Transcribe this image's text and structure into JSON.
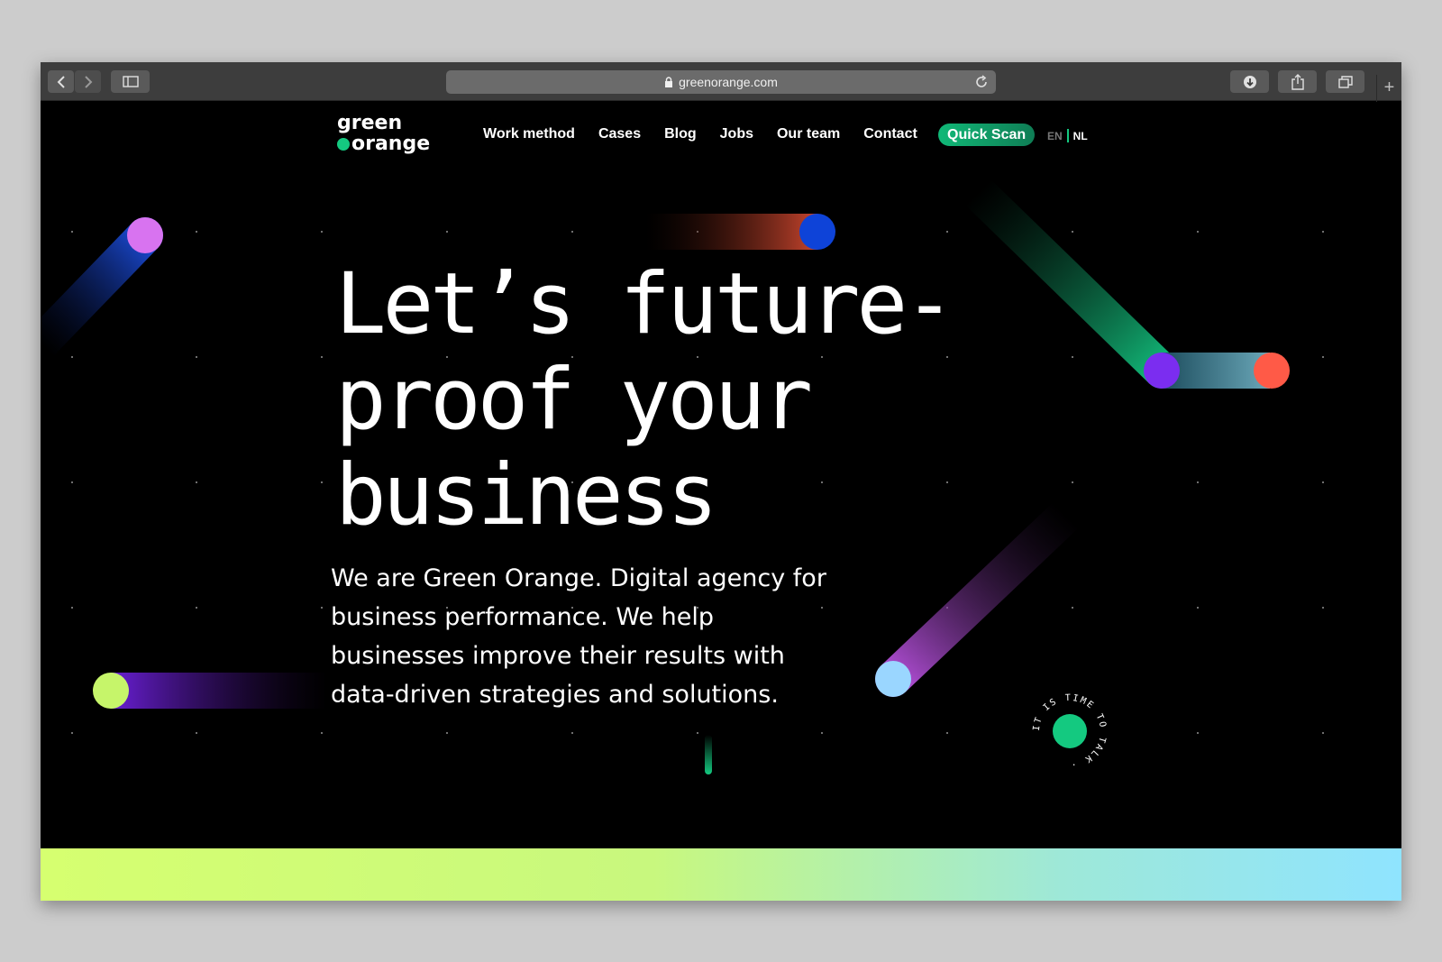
{
  "browser": {
    "url": "greenorange.com",
    "icons": {
      "back": "chevron-left-icon",
      "forward": "chevron-right-icon",
      "sidebar": "sidebar-icon",
      "lock": "lock-icon",
      "reload": "reload-icon",
      "download": "download-icon",
      "share": "share-icon",
      "tabs": "tabs-icon",
      "new_tab": "plus-icon"
    }
  },
  "site": {
    "logo": {
      "line1": "green",
      "line2": "orange"
    },
    "nav": [
      "Work method",
      "Cases",
      "Blog",
      "Jobs",
      "Our team",
      "Contact"
    ],
    "quick_scan": "Quick Scan",
    "lang": {
      "en": "EN",
      "nl": "NL"
    },
    "hero": {
      "line1": "Let’s future-",
      "line2": "proof your",
      "line3": "business"
    },
    "intro": "We are Green Orange. Digital agency for business performance. We help businesses improve their results with data-driven strategies and solutions.",
    "stamp_text": "IT IS TIME TO TALK · "
  },
  "colors": {
    "accent_green": "#14c980",
    "background": "#000000",
    "bar_start": "#d6ff70",
    "bar_end": "#8fe4ff"
  }
}
